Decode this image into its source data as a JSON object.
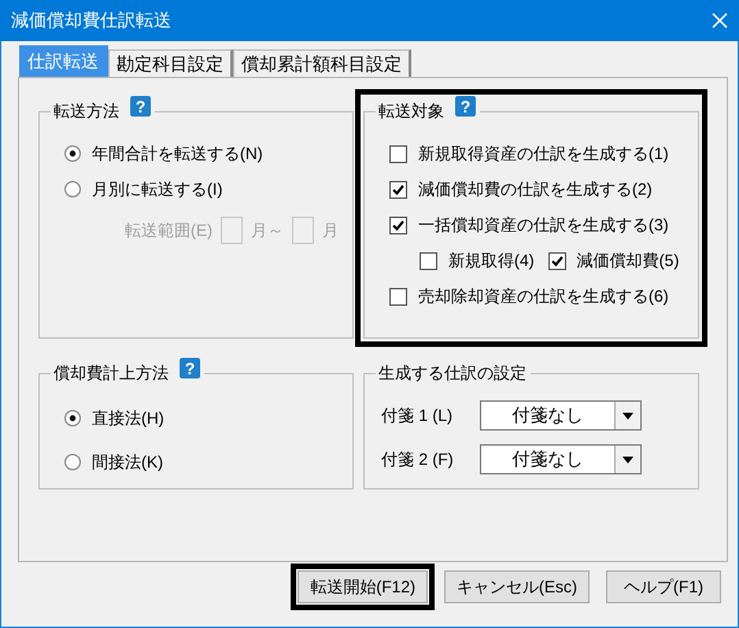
{
  "window": {
    "title": "減価償却費仕訳転送"
  },
  "tabs": [
    {
      "label": "仕訳転送",
      "selected": true
    },
    {
      "label": "勘定科目設定",
      "selected": false
    },
    {
      "label": "償却累計額科目設定",
      "selected": false
    }
  ],
  "transfer_method": {
    "title": "転送方法",
    "help": "?",
    "options": [
      {
        "label": "年間合計を転送する(N)",
        "selected": true
      },
      {
        "label": "月別に転送する(I)",
        "selected": false
      }
    ],
    "range": {
      "label": "転送範囲(E)",
      "from_unit": "月～",
      "to_unit": "月",
      "disabled": true
    }
  },
  "transfer_targets": {
    "title": "転送対象",
    "help": "?",
    "highlighted": true,
    "items": [
      {
        "label": "新規取得資産の仕訳を生成する(1)",
        "checked": false
      },
      {
        "label": "減価償却費の仕訳を生成する(2)",
        "checked": true
      },
      {
        "label": "一括償却資産の仕訳を生成する(3)",
        "checked": true,
        "children": [
          {
            "label": "新規取得(4)",
            "checked": false
          },
          {
            "label": "減価償却費(5)",
            "checked": true
          }
        ]
      },
      {
        "label": "売却除却資産の仕訳を生成する(6)",
        "checked": false
      }
    ]
  },
  "expense_method": {
    "title": "償却費計上方法",
    "help": "?",
    "options": [
      {
        "label": "直接法(H)",
        "selected": true
      },
      {
        "label": "間接法(K)",
        "selected": false
      }
    ]
  },
  "journal_settings": {
    "title": "生成する仕訳の設定",
    "fields": [
      {
        "label": "付箋 1 (L)",
        "value": "付箋なし"
      },
      {
        "label": "付箋 2 (F)",
        "value": "付箋なし"
      }
    ]
  },
  "buttons": [
    {
      "label": "転送開始(F12)",
      "highlighted": true
    },
    {
      "label": "キャンセル(Esc)",
      "highlighted": false
    },
    {
      "label": "ヘルプ(F1)",
      "highlighted": false
    }
  ]
}
